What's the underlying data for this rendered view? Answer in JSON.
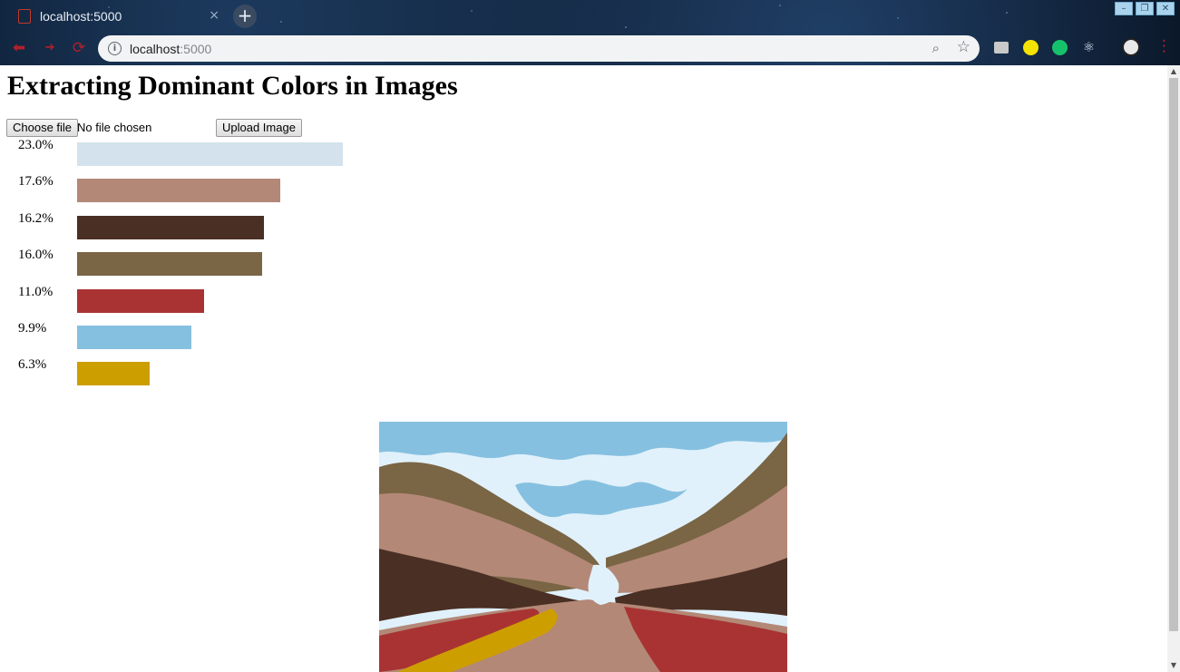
{
  "browser": {
    "tab_title": "localhost:5000",
    "tab_close": "×",
    "new_tab": "+",
    "url_host": "localhost",
    "url_port": ":5000",
    "window_controls": [
      "–",
      "❐",
      "✕"
    ]
  },
  "page": {
    "heading": "Extracting Dominant Colors in Images",
    "choose_file_label": "Choose file",
    "file_status": "No file chosen",
    "upload_label": "Upload Image"
  },
  "chart_data": {
    "type": "bar",
    "orientation": "horizontal",
    "categories": [
      "23.0%",
      "17.6%",
      "16.2%",
      "16.0%",
      "11.0%",
      "9.9%",
      "6.3%"
    ],
    "values": [
      23.0,
      17.6,
      16.2,
      16.0,
      11.0,
      9.9,
      6.3
    ],
    "colors": [
      "#d3e2ed",
      "#b38877",
      "#4a2f24",
      "#7a6545",
      "#a93333",
      "#86c0e0",
      "#cd9e00"
    ],
    "xlim": [
      0,
      23.0
    ],
    "grid": false
  },
  "image": {
    "palette": {
      "sky_light": "#e0f1fb",
      "sky_blue": "#86c0e0",
      "tan": "#b38877",
      "dark_brown": "#4a2f24",
      "olive": "#7a6545",
      "red": "#a93333",
      "gold": "#cd9e00",
      "pale": "#d3e2ed"
    }
  }
}
